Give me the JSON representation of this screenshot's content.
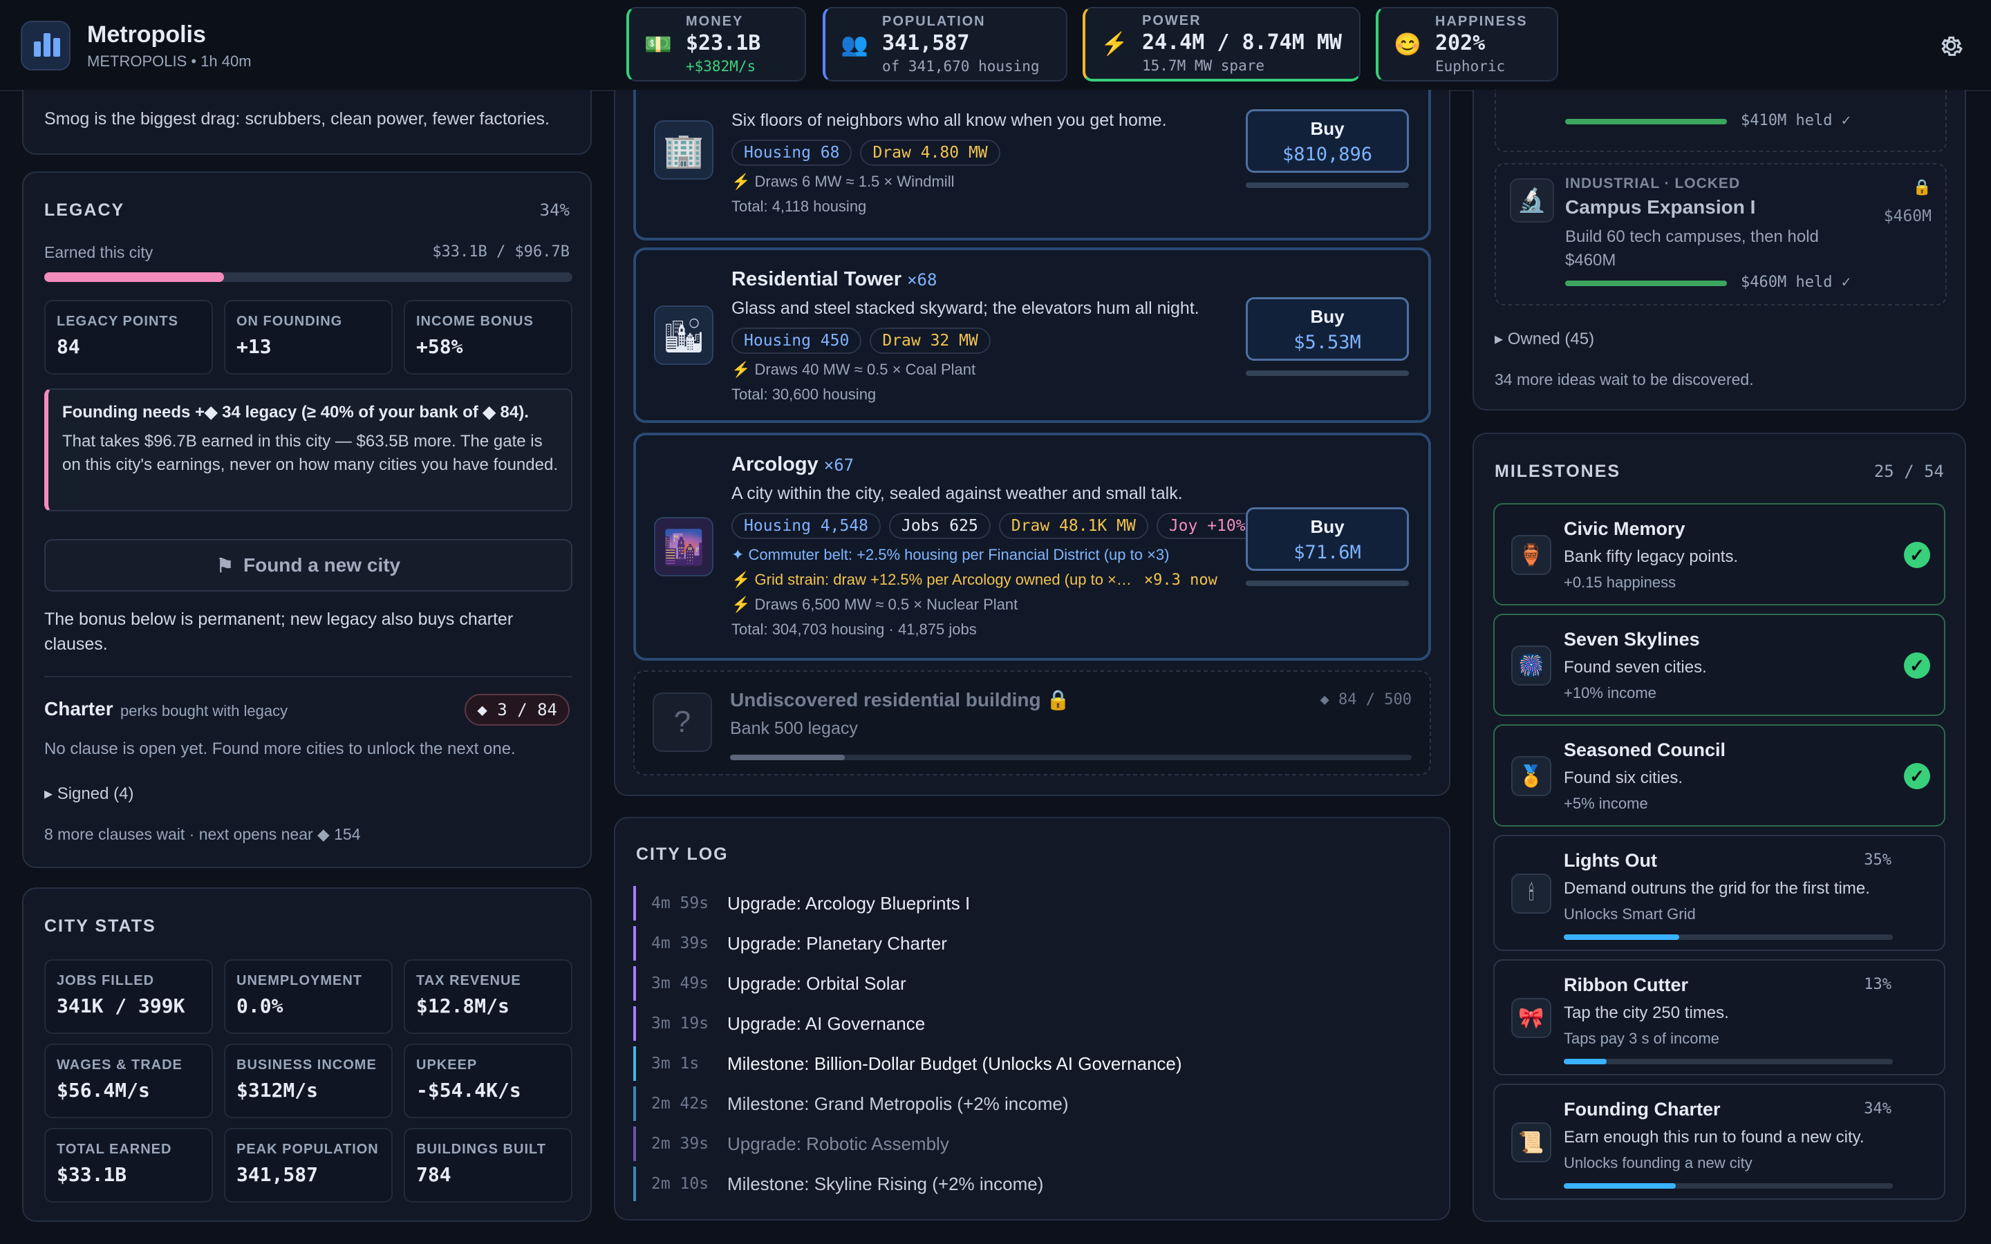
{
  "header": {
    "title": "Metropolis",
    "subtitle": "METROPOLIS • 1h 40m",
    "stats": [
      {
        "label": "MONEY",
        "value": "$23.1B",
        "sub": "+$382M/s",
        "icon": "money-icon"
      },
      {
        "label": "POPULATION",
        "value": "341,587",
        "sub": "of 341,670 housing",
        "icon": "people-icon"
      },
      {
        "label": "POWER",
        "value": "24.4M / 8.74M MW",
        "sub": "15.7M MW spare",
        "icon": "bolt-icon"
      },
      {
        "label": "HAPPINESS",
        "value": "202%",
        "sub": "Euphoric",
        "icon": "smile-icon"
      }
    ]
  },
  "left": {
    "smog_note": "Smog is the biggest drag: scrubbers, clean power, fewer factories.",
    "legacy": {
      "title": "LEGACY",
      "percent": "34%",
      "earned_label": "Earned this city",
      "earned_value": "$33.1B / $96.7B",
      "progress": 0.34,
      "cards": [
        {
          "label": "LEGACY POINTS",
          "value": "84"
        },
        {
          "label": "ON FOUNDING",
          "value": "+13"
        },
        {
          "label": "INCOME BONUS",
          "value": "+58%"
        }
      ],
      "notice_title": "Founding needs +◆ 34 legacy (≥ 40% of your bank of ◆ 84).",
      "notice_body": "That takes $96.7B earned in this city — $63.5B more. The gate is on this city's earnings, never on how many cities you have founded.",
      "found_button": "Found a new city",
      "bonus_note": "The bonus below is permanent; new legacy also buys charter clauses.",
      "charter_title": "Charter",
      "charter_sub": "perks bought with legacy",
      "charter_badge": "◆ 3 / 84",
      "charter_note": "No clause is open yet. Found more cities to unlock the next one.",
      "signed": "Signed (4)",
      "more": "8 more clauses wait · next opens near ◆ 154"
    },
    "city_stats": {
      "title": "CITY STATS",
      "cards": [
        {
          "label": "JOBS FILLED",
          "value": "341K / 399K"
        },
        {
          "label": "UNEMPLOYMENT",
          "value": "0.0%"
        },
        {
          "label": "TAX REVENUE",
          "value": "$12.8M/s"
        },
        {
          "label": "WAGES & TRADE",
          "value": "$56.4M/s"
        },
        {
          "label": "BUSINESS INCOME",
          "value": "$312M/s"
        },
        {
          "label": "UPKEEP",
          "value": "-$54.4K/s"
        },
        {
          "label": "TOTAL EARNED",
          "value": "$33.1B"
        },
        {
          "label": "PEAK POPULATION",
          "value": "341,587"
        },
        {
          "label": "BUILDINGS BUILT",
          "value": "784"
        }
      ]
    }
  },
  "center": {
    "buildings": [
      {
        "name": "",
        "desc": "Six floors of neighbors who all know when you get home.",
        "chip1": "Housing 68",
        "chip2": "Draw 4.80 MW",
        "power": "Draws 6 MW ≈ 1.5 × Windmill",
        "total": "Total: 4,118 housing",
        "buy": "Buy",
        "price": "$810,896"
      },
      {
        "name": "Residential Tower",
        "count": "×68",
        "desc": "Glass and steel stacked skyward; the elevators hum all night.",
        "chip1": "Housing 450",
        "chip2": "Draw 32 MW",
        "power": "Draws 40 MW ≈ 0.5 × Coal Plant",
        "total": "Total: 30,600 housing",
        "buy": "Buy",
        "price": "$5.53M"
      },
      {
        "name": "Arcology",
        "count": "×67",
        "desc": "A city within the city, sealed against weather and small talk.",
        "chip1": "Housing 4,548",
        "chip2": "Jobs 625",
        "chip3": "Draw 48.1K MW",
        "chip4": "Joy +10%",
        "line1": "✦ Commuter belt: +2.5% housing per Financial District (up to ×3)",
        "line2": "⚡ Grid strain: draw +12.5% per Arcology owned (up to ×…",
        "line2b": "×9.3 now",
        "power": "Draws 6,500 MW ≈ 0.5 × Nuclear Plant",
        "total": "Total: 304,703 housing · 41,875 jobs",
        "buy": "Buy",
        "price": "$71.6M"
      }
    ],
    "locked": {
      "name": "Undiscovered residential building",
      "cond": "Bank 500 legacy",
      "prog": "◆ 84 / 500",
      "progress": 0.168
    },
    "log": {
      "title": "CITY LOG",
      "rows": [
        {
          "time": "4m 59s",
          "text": "Upgrade: Arcology Blueprints I"
        },
        {
          "time": "4m 39s",
          "text": "Upgrade: Planetary Charter"
        },
        {
          "time": "3m 49s",
          "text": "Upgrade: Orbital Solar"
        },
        {
          "time": "3m 19s",
          "text": "Upgrade: AI Governance"
        },
        {
          "time": "3m 1s",
          "text": "Milestone: Billion-Dollar Budget (Unlocks AI Governance)"
        },
        {
          "time": "2m 42s",
          "text": "Milestone: Grand Metropolis (+2% income)"
        },
        {
          "time": "2m 39s",
          "text": "Upgrade: Robotic Assembly"
        },
        {
          "time": "2m 10s",
          "text": "Milestone: Skyline Rising (+2% income)"
        }
      ]
    }
  },
  "right": {
    "held1": "$410M held ✓",
    "locked_card": {
      "tag": "INDUSTRIAL · LOCKED",
      "title": "Campus Expansion I",
      "desc": "Build 60 tech campuses, then hold $460M",
      "price": "$460M",
      "held": "$460M held ✓"
    },
    "owned": "Owned (45)",
    "ideas": "34 more ideas wait to be discovered.",
    "milestones": {
      "title": "MILESTONES",
      "count": "25 / 54",
      "items": [
        {
          "title": "Civic Memory",
          "desc": "Bank fifty legacy points.",
          "extra": "+0.15 happiness",
          "done": true,
          "icon": "urn-icon"
        },
        {
          "title": "Seven Skylines",
          "desc": "Found seven cities.",
          "extra": "+10% income",
          "done": true,
          "icon": "fireworks-icon"
        },
        {
          "title": "Seasoned Council",
          "desc": "Found six cities.",
          "extra": "+5% income",
          "done": true,
          "icon": "medal-icon"
        },
        {
          "title": "Lights Out",
          "desc": "Demand outruns the grid for the first time.",
          "extra": "Unlocks Smart Grid",
          "pct": "35%",
          "progress": 0.35,
          "icon": "candle-icon"
        },
        {
          "title": "Ribbon Cutter",
          "desc": "Tap the city 250 times.",
          "extra": "Taps pay 3 s of income",
          "pct": "13%",
          "progress": 0.13,
          "icon": "ribbon-icon"
        },
        {
          "title": "Founding Charter",
          "desc": "Earn enough this run to found a new city.",
          "extra": "Unlocks founding a new city",
          "pct": "34%",
          "progress": 0.34,
          "icon": "scroll-icon"
        }
      ]
    }
  }
}
